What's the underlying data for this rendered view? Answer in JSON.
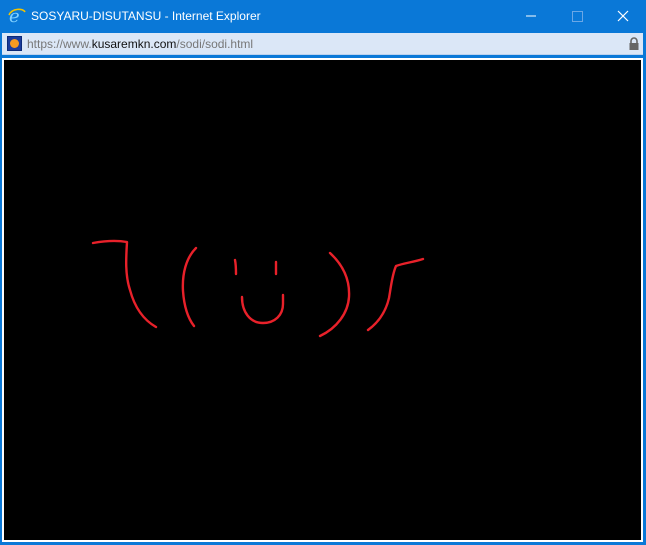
{
  "window": {
    "title": "SOSYARU-DISUTANSU - Internet Explorer",
    "controls": [
      "minimize",
      "maximize",
      "close"
    ]
  },
  "address_bar": {
    "scheme": "https://www.",
    "domain": "kusaremkn.com",
    "path": "/sodi/sodi.html",
    "icons": [
      "site-favicon",
      "lock-icon"
    ]
  },
  "content": {
    "background": "#000000",
    "stroke_color": "#e8212a",
    "drawing": "hand-drawn shrug emoticon"
  },
  "colors": {
    "titlebar": "#0a78d7",
    "addressbar": "#dbe7f7"
  }
}
